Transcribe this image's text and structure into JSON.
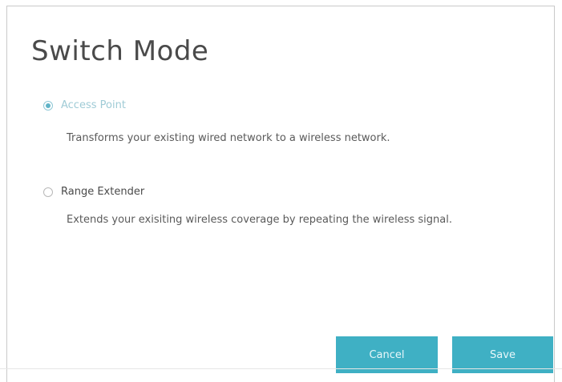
{
  "dialog": {
    "title": "Switch Mode",
    "options": [
      {
        "label": "Access Point",
        "selected": true,
        "description": "Transforms your existing wired network to a wireless network."
      },
      {
        "label": "Range Extender",
        "selected": false,
        "description": "Extends your exisiting wireless coverage by repeating the wireless signal."
      }
    ],
    "buttons": {
      "cancel_label": "Cancel",
      "save_label": "Save"
    }
  },
  "colors": {
    "accent": "#3fb0c4",
    "title_text": "#4a4a4a",
    "selected_label": "#9fcbd6"
  }
}
